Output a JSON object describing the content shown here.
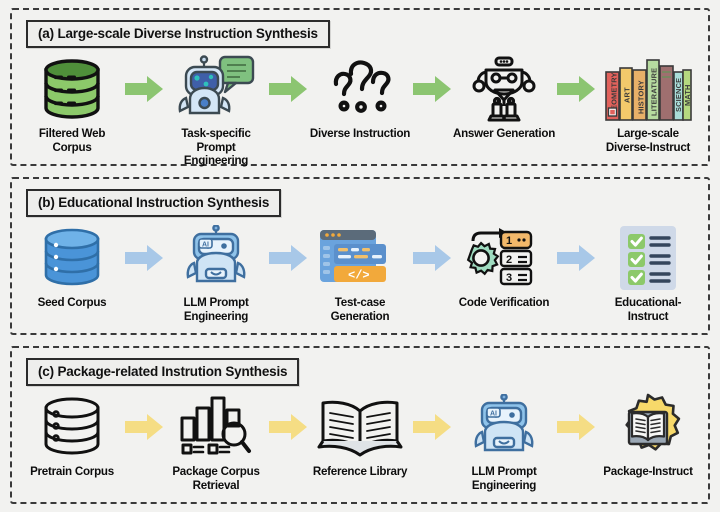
{
  "figure": {
    "type": "flow-diagram",
    "background_color": "#f2f2f0",
    "panel_count": 3
  },
  "panels": [
    {
      "id": "panel-a",
      "title": "(a) Large-scale Diverse Instruction Synthesis",
      "arrow_color": "#8cc571",
      "nodes": [
        {
          "label": "Filtered Web\nCorpus",
          "icon": "green-database-icon"
        },
        {
          "label": "Task-specific\nPrompt Engineering",
          "icon": "robot-chat-bubble-icon"
        },
        {
          "label": "Diverse Instruction",
          "icon": "question-marks-icon"
        },
        {
          "label": "Answer Generation",
          "icon": "outline-robot-icon"
        },
        {
          "label": "Large-scale\nDiverse-Instruct",
          "icon": "bookshelf-icon"
        }
      ],
      "book_spines": [
        "GEOMETRY",
        "ART",
        "HISTORY",
        "LITERATURE",
        "SCIENCE",
        "MATH"
      ]
    },
    {
      "id": "panel-b",
      "title": "(b) Educational Instruction Synthesis",
      "arrow_color": "#a8c8e8",
      "nodes": [
        {
          "label": "Seed Corpus",
          "icon": "blue-database-icon"
        },
        {
          "label": "LLM Prompt\nEngineering",
          "icon": "ai-robot-icon"
        },
        {
          "label": "Test-case Generation",
          "icon": "code-window-icon"
        },
        {
          "label": "Code Verification",
          "icon": "gear-checklist-icon"
        },
        {
          "label": "Educational-Instruct",
          "icon": "checklist-document-icon"
        }
      ],
      "code_glyph": "</>",
      "step_numbers": [
        "1",
        "2",
        "3"
      ],
      "ai_badge": "AI"
    },
    {
      "id": "panel-c",
      "title": "(c) Package-related Instrution Synthesis",
      "arrow_color": "#f5dd84",
      "nodes": [
        {
          "label": "Pretrain Corpus",
          "icon": "outline-database-icon"
        },
        {
          "label": "Package Corpus\nRetrieval",
          "icon": "bar-chart-search-icon"
        },
        {
          "label": "Reference Library",
          "icon": "open-book-icon"
        },
        {
          "label": "LLM Prompt\nEngineering",
          "icon": "ai-robot-icon"
        },
        {
          "label": "Package-Instruct",
          "icon": "gear-book-badge-icon"
        }
      ],
      "ai_badge": "AI"
    }
  ],
  "colors": {
    "panel_border": "#3a3a3a",
    "title_border": "#2b2b2b",
    "arrow_green": "#8cc571",
    "arrow_blue": "#a8c8e8",
    "arrow_yellow": "#f5dd84",
    "db_green": "#8cc96a",
    "db_blue": "#4a94d8",
    "robot_blue": "#c8ddf0",
    "bubble_green": "#7fc17f",
    "code_orange": "#f2a93b",
    "code_blue": "#6aa3dd",
    "gear_green": "#9fdcc0",
    "check_green": "#8cc96a",
    "badge_yellow": "#f7d96a",
    "text": "#0d0d0d"
  }
}
